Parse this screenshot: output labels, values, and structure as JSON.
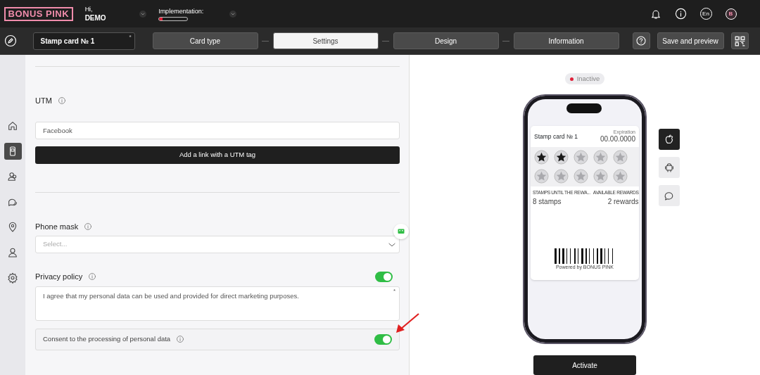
{
  "header": {
    "logo": "BONUS PINK",
    "greeting": "Hi,",
    "user": "DEMO",
    "implementation": {
      "label": "Implementation:",
      "level": 0.12
    },
    "language": "En",
    "avatar": "B"
  },
  "toolbar": {
    "card_name": "Stamp card № 1",
    "required_mark": "*",
    "steps": [
      {
        "label": "Card type",
        "selected": false
      },
      {
        "label": "Settings",
        "selected": true
      },
      {
        "label": "Design",
        "selected": false
      },
      {
        "label": "Information",
        "selected": false
      }
    ],
    "save_button": "Save and preview"
  },
  "sidebar": {
    "items": [
      {
        "kind": "home",
        "selected": false
      },
      {
        "kind": "card",
        "selected": true
      },
      {
        "kind": "clients",
        "selected": false
      },
      {
        "kind": "chat",
        "selected": false
      },
      {
        "kind": "location",
        "selected": false
      },
      {
        "kind": "user",
        "selected": false
      },
      {
        "kind": "settings",
        "selected": false
      }
    ]
  },
  "form": {
    "utm": {
      "label": "UTM",
      "value": "Facebook",
      "button": "Add a link with a UTM tag"
    },
    "phone_mask": {
      "label": "Phone mask",
      "placeholder": "Select..."
    },
    "privacy_policy": {
      "label": "Privacy policy",
      "on": true,
      "text": "I agree that my personal data can be used and provided for direct marketing purposes.",
      "required_mark": "*"
    },
    "consent": {
      "label": "Consent to the processing of personal data",
      "on": true
    }
  },
  "preview": {
    "status": {
      "label": "Inactive",
      "active": false
    },
    "card": {
      "title": "Stamp card № 1",
      "expiration_label": "Expiration",
      "expiration": "00.00.0000",
      "stamps": [
        {
          "filled": true
        },
        {
          "filled": true
        },
        {
          "filled": false
        },
        {
          "filled": false
        },
        {
          "filled": false
        },
        {
          "filled": false
        },
        {
          "filled": false
        },
        {
          "filled": false
        },
        {
          "filled": false
        },
        {
          "filled": false
        }
      ],
      "stats": [
        {
          "label": "STAMPS UNTIL THE REWA...",
          "value": "8 stamps"
        },
        {
          "label": "AVAILABLE REWARDS",
          "value": "2 rewards"
        }
      ],
      "footer": "Powered by BONUS PINK"
    },
    "platforms": [
      {
        "kind": "apple",
        "selected": true
      },
      {
        "kind": "android",
        "selected": false
      },
      {
        "kind": "message",
        "selected": false
      }
    ],
    "activate": "Activate"
  }
}
